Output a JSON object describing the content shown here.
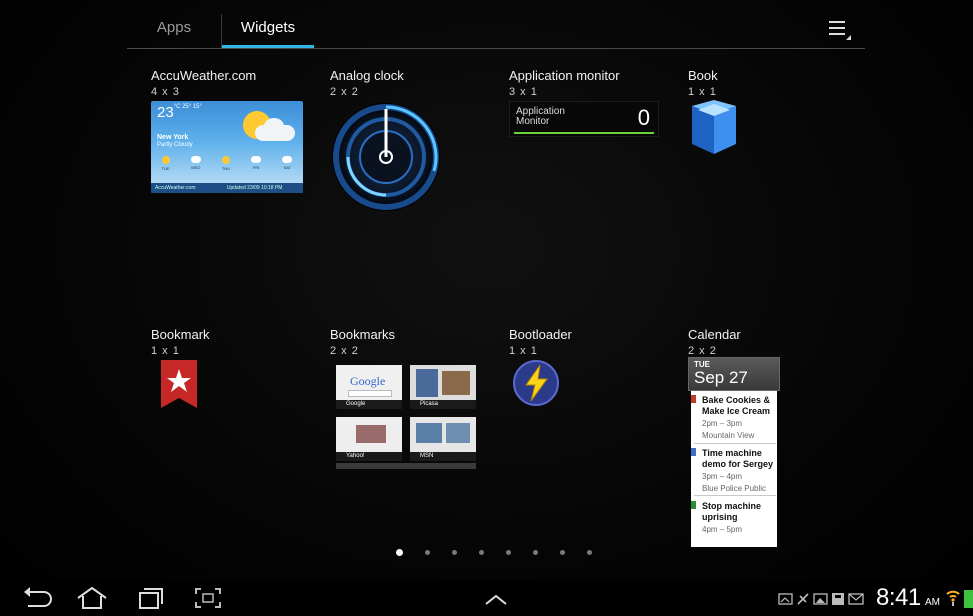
{
  "tabs": {
    "apps_label": "Apps",
    "widgets_label": "Widgets",
    "active": "Widgets"
  },
  "accent_color": "#33b5e5",
  "widgets": [
    {
      "name": "AccuWeather.com",
      "size": "4 x 3",
      "preview": {
        "temp": "23",
        "unit_hi_lo": "°C 25° 15°",
        "city": "New York",
        "condition": "Partly Cloudy",
        "days": [
          "TUE",
          "WED",
          "THU",
          "FRI",
          "SAT"
        ],
        "footer_brand": "AccuWeather.com",
        "footer_updated": "Updated 23/09 10:18 PM"
      }
    },
    {
      "name": "Analog clock",
      "size": "2 x 2"
    },
    {
      "name": "Application monitor",
      "size": "3 x 1",
      "preview": {
        "label": "Application Monitor",
        "count": "0"
      }
    },
    {
      "name": "Book",
      "size": "1 x 1"
    },
    {
      "name": "Bookmark",
      "size": "1 x 1"
    },
    {
      "name": "Bookmarks",
      "size": "2 x 2",
      "preview": {
        "tiles": [
          "Google",
          "Picasa",
          "Yahoo!",
          "MSN"
        ]
      }
    },
    {
      "name": "Bootloader",
      "size": "1 x 1"
    },
    {
      "name": "Calendar",
      "size": "2 x 2",
      "preview": {
        "dow": "TUE",
        "date": "Sep 27",
        "events": [
          {
            "title_1": "Bake Cookies &",
            "title_2": "Make Ice Cream",
            "time": "2pm – 3pm",
            "place": "Mountain View",
            "color": "#c0392b"
          },
          {
            "title_1": "Time machine",
            "title_2": "demo for Sergey",
            "time": "3pm – 4pm",
            "place": "Blue Police Public",
            "color": "#3d6fc9"
          },
          {
            "title_1": "Stop machine",
            "title_2": "uprising",
            "time": "4pm – 5pm",
            "place": "",
            "color": "#2e8b3a"
          }
        ]
      }
    }
  ],
  "pager": {
    "pages": 8,
    "current": 1
  },
  "status_bar": {
    "time": "8:41",
    "ampm": "AM",
    "icons": [
      "screenshot-icon",
      "usb-debug-icon",
      "gallery-icon",
      "sd-card-icon",
      "email-icon",
      "wifi-icon",
      "battery-icon"
    ]
  },
  "nav_buttons": [
    "back-icon",
    "home-icon",
    "recent-apps-icon",
    "screenshot-capture-icon",
    "up-arrow-icon"
  ]
}
